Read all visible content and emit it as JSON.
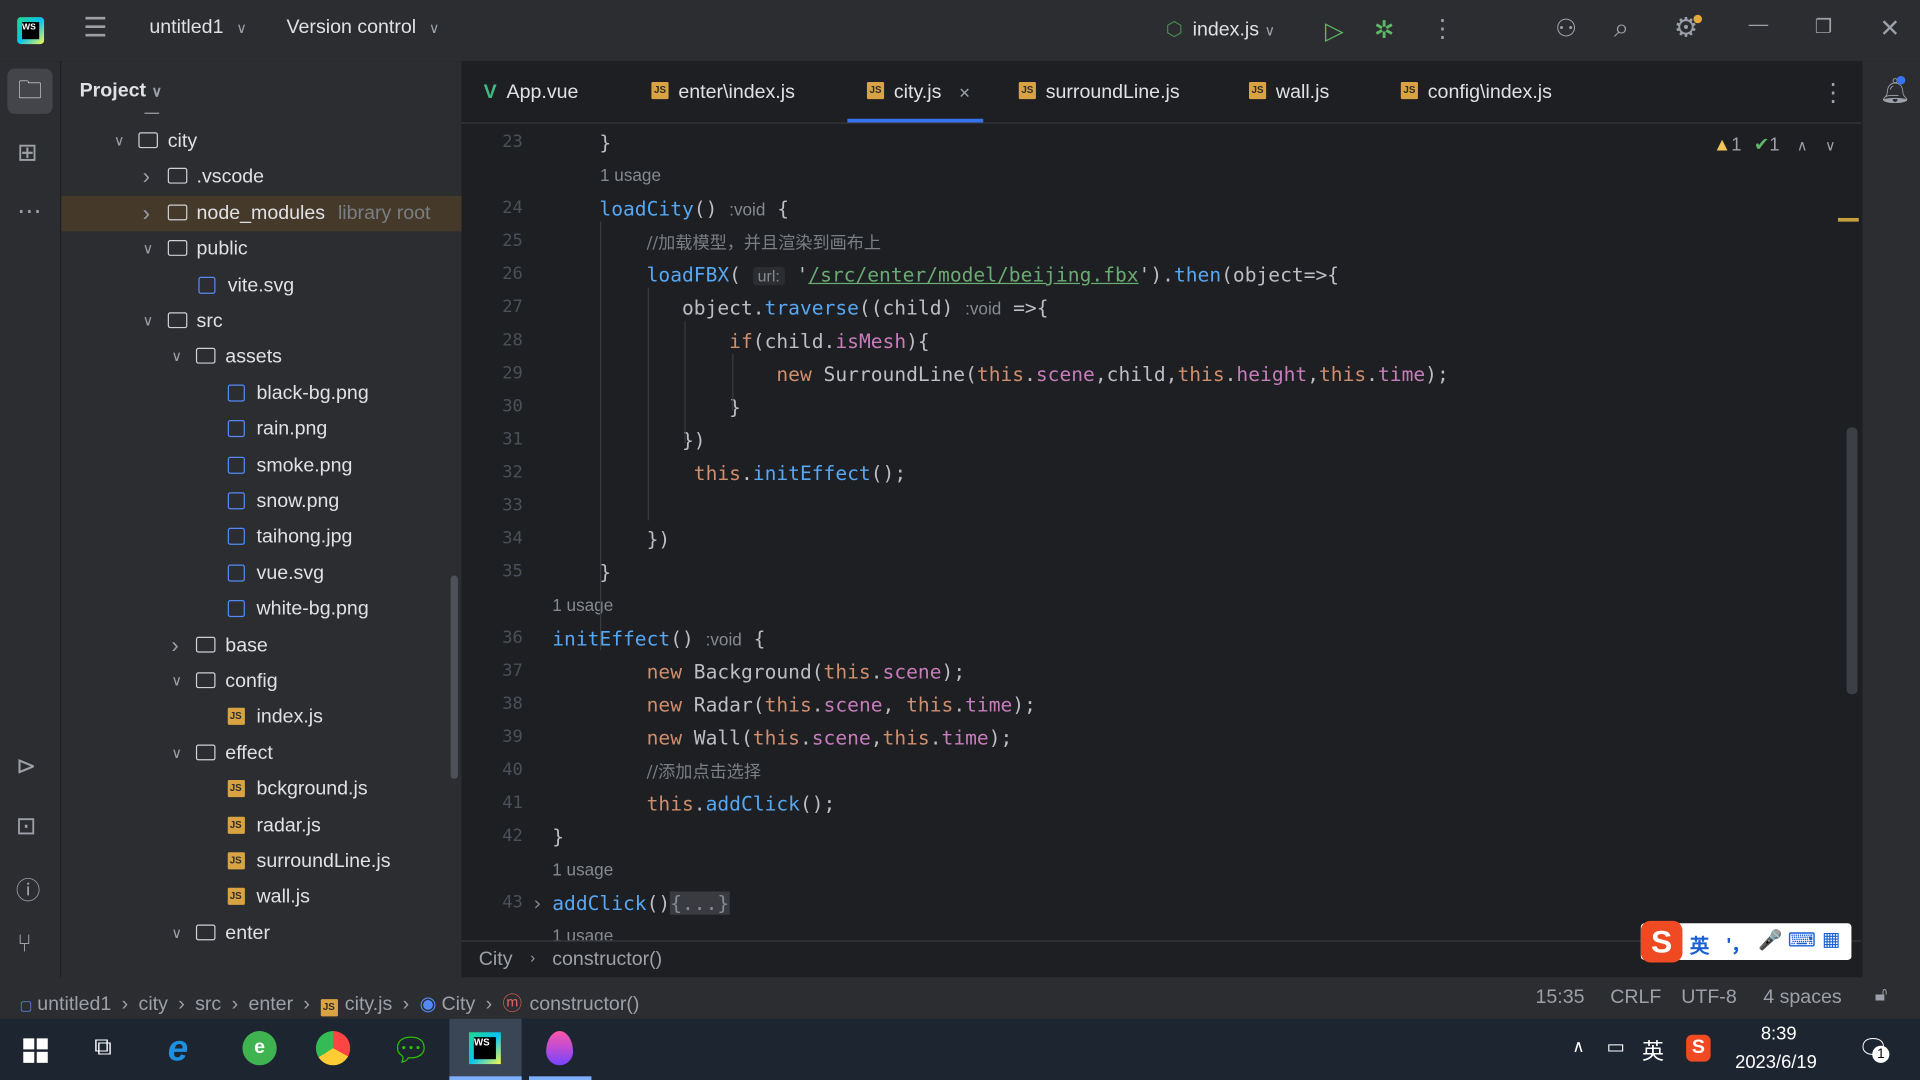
{
  "titlebar": {
    "project": "untitled1",
    "vcs": "Version control",
    "run_config": "index.js"
  },
  "sidebar": {
    "title": "Project",
    "tree": [
      {
        "label": "city",
        "level": 0,
        "type": "folder",
        "expanded": true
      },
      {
        "label": ".vscode",
        "level": 1,
        "type": "folder",
        "expanded": false
      },
      {
        "label": "node_modules",
        "level": 1,
        "type": "folder",
        "expanded": false,
        "note": "library root",
        "selected": true
      },
      {
        "label": "public",
        "level": 1,
        "type": "folder",
        "expanded": true
      },
      {
        "label": "vite.svg",
        "level": 2,
        "type": "image"
      },
      {
        "label": "src",
        "level": 1,
        "type": "folder",
        "expanded": true
      },
      {
        "label": "assets",
        "level": 2,
        "type": "folder",
        "expanded": true
      },
      {
        "label": "black-bg.png",
        "level": 3,
        "type": "image"
      },
      {
        "label": "rain.png",
        "level": 3,
        "type": "image"
      },
      {
        "label": "smoke.png",
        "level": 3,
        "type": "image"
      },
      {
        "label": "snow.png",
        "level": 3,
        "type": "image"
      },
      {
        "label": "taihong.jpg",
        "level": 3,
        "type": "image"
      },
      {
        "label": "vue.svg",
        "level": 3,
        "type": "image"
      },
      {
        "label": "white-bg.png",
        "level": 3,
        "type": "image"
      },
      {
        "label": "base",
        "level": 2,
        "type": "folder",
        "expanded": false
      },
      {
        "label": "config",
        "level": 2,
        "type": "folder",
        "expanded": true
      },
      {
        "label": "index.js",
        "level": 3,
        "type": "js"
      },
      {
        "label": "effect",
        "level": 2,
        "type": "folder",
        "expanded": true
      },
      {
        "label": "bckground.js",
        "level": 3,
        "type": "js"
      },
      {
        "label": "radar.js",
        "level": 3,
        "type": "js"
      },
      {
        "label": "surroundLine.js",
        "level": 3,
        "type": "js"
      },
      {
        "label": "wall.js",
        "level": 3,
        "type": "js"
      },
      {
        "label": "enter",
        "level": 2,
        "type": "folder",
        "expanded": true
      }
    ]
  },
  "tabs": [
    {
      "label": "App.vue",
      "icon": "vue-icon"
    },
    {
      "label": "enter\\index.js",
      "icon": "js-icon"
    },
    {
      "label": "city.js",
      "icon": "js-icon",
      "active": true,
      "closable": true
    },
    {
      "label": "surroundLine.js",
      "icon": "js-icon"
    },
    {
      "label": "wall.js",
      "icon": "js-icon"
    },
    {
      "label": "config\\index.js",
      "icon": "js-icon"
    }
  ],
  "inspections": {
    "warnings": "1",
    "ok": "1"
  },
  "code": [
    {
      "n": "23",
      "t": [
        [
          "p",
          "    }"
        ]
      ]
    },
    {
      "usage": "1 usage",
      "indent": 4
    },
    {
      "n": "24",
      "t": [
        [
          "p",
          "    "
        ],
        [
          "fn",
          "loadCity"
        ],
        [
          "p",
          "() "
        ],
        [
          "hint",
          ":void"
        ],
        [
          "p",
          " {"
        ]
      ]
    },
    {
      "n": "25",
      "t": [
        [
          "p",
          "        "
        ],
        [
          "cm",
          "//加载模型，并且渲染到画布上"
        ]
      ]
    },
    {
      "n": "26",
      "t": [
        [
          "p",
          "        "
        ],
        [
          "fn",
          "loadFBX"
        ],
        [
          "p",
          "( "
        ],
        [
          "hintbox",
          "url:"
        ],
        [
          "p",
          " '"
        ],
        [
          "str",
          "/src/enter/model/beijing.fbx"
        ],
        [
          "p",
          "')."
        ],
        [
          "fn",
          "then"
        ],
        [
          "p",
          "(object=>{"
        ]
      ]
    },
    {
      "n": "27",
      "t": [
        [
          "p",
          "           object."
        ],
        [
          "fn",
          "traverse"
        ],
        [
          "p",
          "((child) "
        ],
        [
          "hint",
          ":void"
        ],
        [
          "p",
          " =>{"
        ]
      ]
    },
    {
      "n": "28",
      "t": [
        [
          "p",
          "               "
        ],
        [
          "kw",
          "if"
        ],
        [
          "p",
          "(child."
        ],
        [
          "prop",
          "isMesh"
        ],
        [
          "p",
          "){"
        ]
      ]
    },
    {
      "n": "29",
      "t": [
        [
          "p",
          "                   "
        ],
        [
          "kw",
          "new"
        ],
        [
          "p",
          " SurroundLine("
        ],
        [
          "kw",
          "this"
        ],
        [
          "p",
          "."
        ],
        [
          "prop",
          "scene"
        ],
        [
          "p",
          ",child,"
        ],
        [
          "kw",
          "this"
        ],
        [
          "p",
          "."
        ],
        [
          "prop",
          "height"
        ],
        [
          "p",
          ","
        ],
        [
          "kw",
          "this"
        ],
        [
          "p",
          "."
        ],
        [
          "prop",
          "time"
        ],
        [
          "p",
          ");"
        ]
      ]
    },
    {
      "n": "30",
      "t": [
        [
          "p",
          "               }"
        ]
      ]
    },
    {
      "n": "31",
      "t": [
        [
          "p",
          "           })"
        ]
      ]
    },
    {
      "n": "32",
      "t": [
        [
          "p",
          "            "
        ],
        [
          "kw",
          "this"
        ],
        [
          "p",
          "."
        ],
        [
          "fn",
          "initEffect"
        ],
        [
          "p",
          "();"
        ]
      ]
    },
    {
      "n": "33",
      "t": []
    },
    {
      "n": "34",
      "t": [
        [
          "p",
          "        })"
        ]
      ]
    },
    {
      "n": "35",
      "t": [
        [
          "p",
          "    }"
        ]
      ]
    },
    {
      "usage": "1 usage",
      "indent": 0
    },
    {
      "n": "36",
      "t": [
        [
          "fn",
          "initEffect"
        ],
        [
          "p",
          "() "
        ],
        [
          "hint",
          ":void"
        ],
        [
          "p",
          " {"
        ]
      ]
    },
    {
      "n": "37",
      "t": [
        [
          "p",
          "        "
        ],
        [
          "kw",
          "new"
        ],
        [
          "p",
          " Background("
        ],
        [
          "kw",
          "this"
        ],
        [
          "p",
          "."
        ],
        [
          "prop",
          "scene"
        ],
        [
          "p",
          ");"
        ]
      ]
    },
    {
      "n": "38",
      "t": [
        [
          "p",
          "        "
        ],
        [
          "kw",
          "new"
        ],
        [
          "p",
          " Radar("
        ],
        [
          "kw",
          "this"
        ],
        [
          "p",
          "."
        ],
        [
          "prop",
          "scene"
        ],
        [
          "p",
          ", "
        ],
        [
          "kw",
          "this"
        ],
        [
          "p",
          "."
        ],
        [
          "prop",
          "time"
        ],
        [
          "p",
          ");"
        ]
      ]
    },
    {
      "n": "39",
      "t": [
        [
          "p",
          "        "
        ],
        [
          "kw",
          "new"
        ],
        [
          "p",
          " Wall("
        ],
        [
          "kw",
          "this"
        ],
        [
          "p",
          "."
        ],
        [
          "prop",
          "scene"
        ],
        [
          "p",
          ","
        ],
        [
          "kw",
          "this"
        ],
        [
          "p",
          "."
        ],
        [
          "prop",
          "time"
        ],
        [
          "p",
          ");"
        ]
      ]
    },
    {
      "n": "40",
      "t": [
        [
          "p",
          "        "
        ],
        [
          "cm",
          "//添加点击选择"
        ]
      ]
    },
    {
      "n": "41",
      "t": [
        [
          "p",
          "        "
        ],
        [
          "kw",
          "this"
        ],
        [
          "p",
          "."
        ],
        [
          "fn",
          "addClick"
        ],
        [
          "p",
          "();"
        ]
      ]
    },
    {
      "n": "42",
      "t": [
        [
          "p",
          "}"
        ]
      ]
    },
    {
      "usage": "1 usage",
      "indent": 0
    },
    {
      "n": "43",
      "fold": true,
      "t": [
        [
          "fn",
          "addClick"
        ],
        [
          "p",
          "()"
        ],
        [
          "fold",
          "{...}"
        ]
      ]
    },
    {
      "usage": "1 usage",
      "indent": 0
    }
  ],
  "editor_breadcrumb": [
    "City",
    "constructor()"
  ],
  "status": {
    "path": [
      "untitled1",
      "city",
      "src",
      "enter",
      "city.js",
      "City",
      "constructor()"
    ],
    "position": "15:35",
    "line_ending": "CRLF",
    "encoding": "UTF-8",
    "indent": "4 spaces"
  },
  "ime": {
    "label": "英",
    "punct": "'，"
  },
  "taskbar": {
    "time": "8:39",
    "date": "2023/6/19",
    "ime": "英",
    "notifications": "1"
  },
  "colors": {
    "keyword": "#cf8e6d",
    "function": "#56a8f5",
    "property": "#c77dbb",
    "string": "#6aab73",
    "accent": "#3574f0"
  }
}
